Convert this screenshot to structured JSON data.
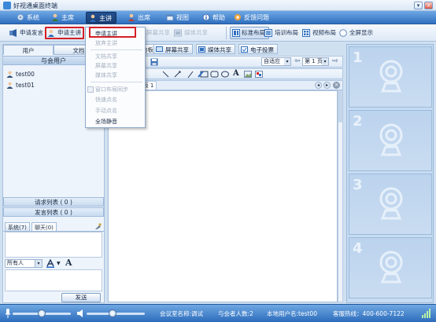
{
  "window": {
    "title": "好视通桌面终端",
    "min": "▾",
    "close": "×"
  },
  "menus": [
    {
      "label": "系统"
    },
    {
      "label": "主席"
    },
    {
      "label": "主讲"
    },
    {
      "label": "出席"
    },
    {
      "label": "视图"
    },
    {
      "label": "帮助"
    },
    {
      "label": "反馈问题"
    }
  ],
  "toolbar": {
    "apply_speak": "申请发言",
    "apply_present": "申请主讲",
    "screen_share": "屏幕共享",
    "media_share": "媒体共享",
    "layout_standard": "标准布局",
    "layout_training": "培训布局",
    "layout_video": "视频布局",
    "fullscreen": "全屏显示"
  },
  "left": {
    "tab_users": "用户",
    "tab_docs": "文档",
    "attendees_header": "与会用户",
    "users": [
      {
        "name": "test00"
      },
      {
        "name": "test01"
      }
    ],
    "request_list": "请求列表 ( 0 )",
    "speak_list": "发言列表 ( 0 )",
    "chat_tab_system": "系统(7)",
    "chat_tab_chat": "聊天(0)",
    "recipient": "所有人",
    "send": "发送"
  },
  "center": {
    "tabs": [
      {
        "label": "白板"
      },
      {
        "label": "屏幕共享"
      },
      {
        "label": "媒体共享"
      },
      {
        "label": "电子投票"
      }
    ],
    "zoom": "自适应",
    "page": "第 1 页",
    "whiteboard_tab": "白板 1"
  },
  "dropdown": {
    "items": [
      {
        "label": "申请主讲",
        "enabled": true
      },
      {
        "label": "放弃主讲",
        "enabled": false
      },
      {
        "label": "文档共享",
        "enabled": false
      },
      {
        "label": "屏幕共享",
        "enabled": false
      },
      {
        "label": "媒体共享",
        "enabled": false
      },
      {
        "label": "窗口布局同步",
        "enabled": false
      },
      {
        "label": "快速点名",
        "enabled": false
      },
      {
        "label": "手动点名",
        "enabled": false
      },
      {
        "label": "全场静音",
        "enabled": true
      }
    ]
  },
  "video": {
    "slots": [
      "1",
      "2",
      "3",
      "4"
    ]
  },
  "status": {
    "room": "会议室名称:调试",
    "count": "与会者人数:2",
    "user": "本地用户名:test00",
    "hotline": "客服热线：400-600-7122",
    "mic_level": 0.5,
    "speaker_level": 0.45
  },
  "colors": {
    "accent": "#2f6fbf",
    "highlight_red": "#d42026"
  }
}
